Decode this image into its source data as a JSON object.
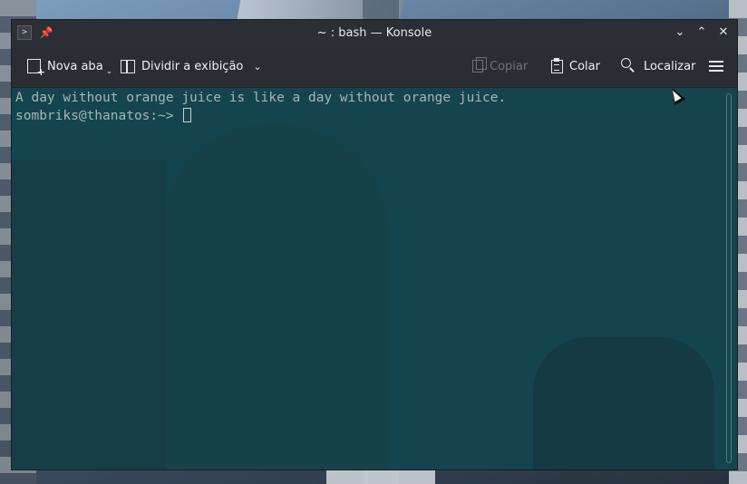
{
  "window": {
    "title": "~ : bash — Konsole",
    "app_icon": "terminal-icon",
    "pin_icon": "pin-icon",
    "controls": {
      "minimize": "chevron-down-icon",
      "maximize": "chevron-up-icon",
      "close": "close-icon"
    },
    "minimize_glyph": "⌄",
    "maximize_glyph": "⌃",
    "close_glyph": "✕"
  },
  "toolbar": {
    "new_tab_label": "Nova aba",
    "split_view_label": "Dividir a exibição",
    "copy_label": "Copiar",
    "paste_label": "Colar",
    "find_label": "Localizar",
    "copy_enabled": false
  },
  "terminal": {
    "lines": [
      "A day without orange juice is like a day without orange juice.",
      "sombriks@thanatos:~> "
    ],
    "background_color": "#104a54",
    "text_color": "#a8b4b8"
  }
}
